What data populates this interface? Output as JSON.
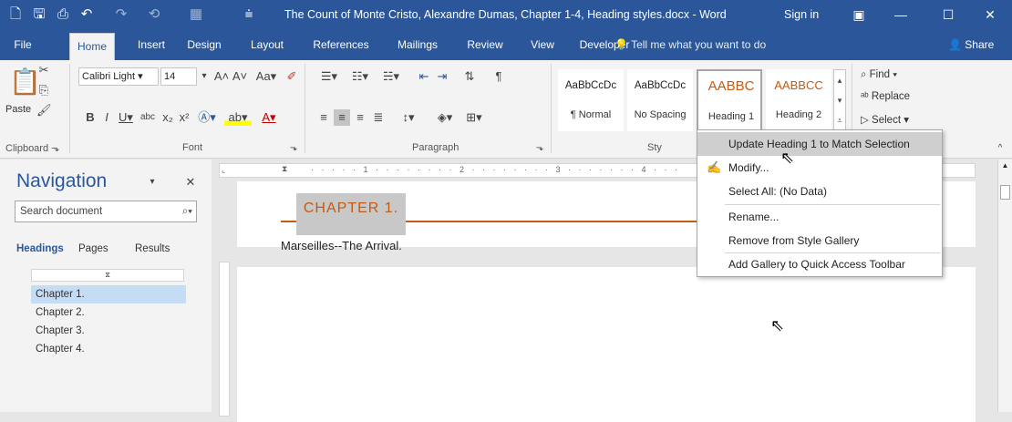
{
  "titlebar": {
    "doc_title": "The Count of Monte Cristo, Alexandre Dumas, Chapter 1-4, Heading styles.docx - Word",
    "sign_in": "Sign in",
    "icons": [
      "word-doc-icon",
      "save-icon",
      "save-as-icon",
      "undo-icon",
      "redo-icon",
      "repeat-icon",
      "more-icon",
      "customize-qat-icon",
      "ribbon-display-icon",
      "minimize-icon",
      "maximize-icon",
      "close-icon"
    ]
  },
  "tabs": [
    "File",
    "Home",
    "Insert",
    "Design",
    "Layout",
    "References",
    "Mailings",
    "Review",
    "View",
    "Developer"
  ],
  "tell_me": "Tell me what you want to do",
  "share": "Share",
  "ribbon": {
    "paste_label": "Paste",
    "font_name": "Calibri Light",
    "font_size": "14",
    "groups": {
      "clipboard": "Clipboard",
      "font": "Font",
      "paragraph": "Paragraph",
      "styles": "Sty"
    },
    "styles": [
      {
        "sample": "AaBbCcDc",
        "name": "¶ Normal"
      },
      {
        "sample": "AaBbCcDc",
        "name": "No Spacing"
      },
      {
        "sample": "AABBC",
        "name": "Heading 1"
      },
      {
        "sample": "AABBCC",
        "name": "Heading 2"
      }
    ],
    "editing": {
      "find": "Find",
      "replace": "Replace",
      "select": "Select"
    }
  },
  "navigation": {
    "title": "Navigation",
    "search_placeholder": "Search document",
    "tabs": [
      "Headings",
      "Pages",
      "Results"
    ],
    "headings": [
      "Chapter 1.",
      "Chapter 2.",
      "Chapter 3.",
      "Chapter 4."
    ]
  },
  "document": {
    "heading": "CHAPTER 1.",
    "body": "Marseilles--The Arrival."
  },
  "context_menu": {
    "items": [
      "Update Heading 1 to Match Selection",
      "Modify...",
      "Select All: (No Data)",
      "Rename...",
      "Remove from Style Gallery",
      "Add Gallery to Quick Access Toolbar"
    ]
  },
  "colors": {
    "word_blue": "#2b579a",
    "heading_orange": "#c55a11",
    "selected_heading": "#c5dcf5"
  }
}
